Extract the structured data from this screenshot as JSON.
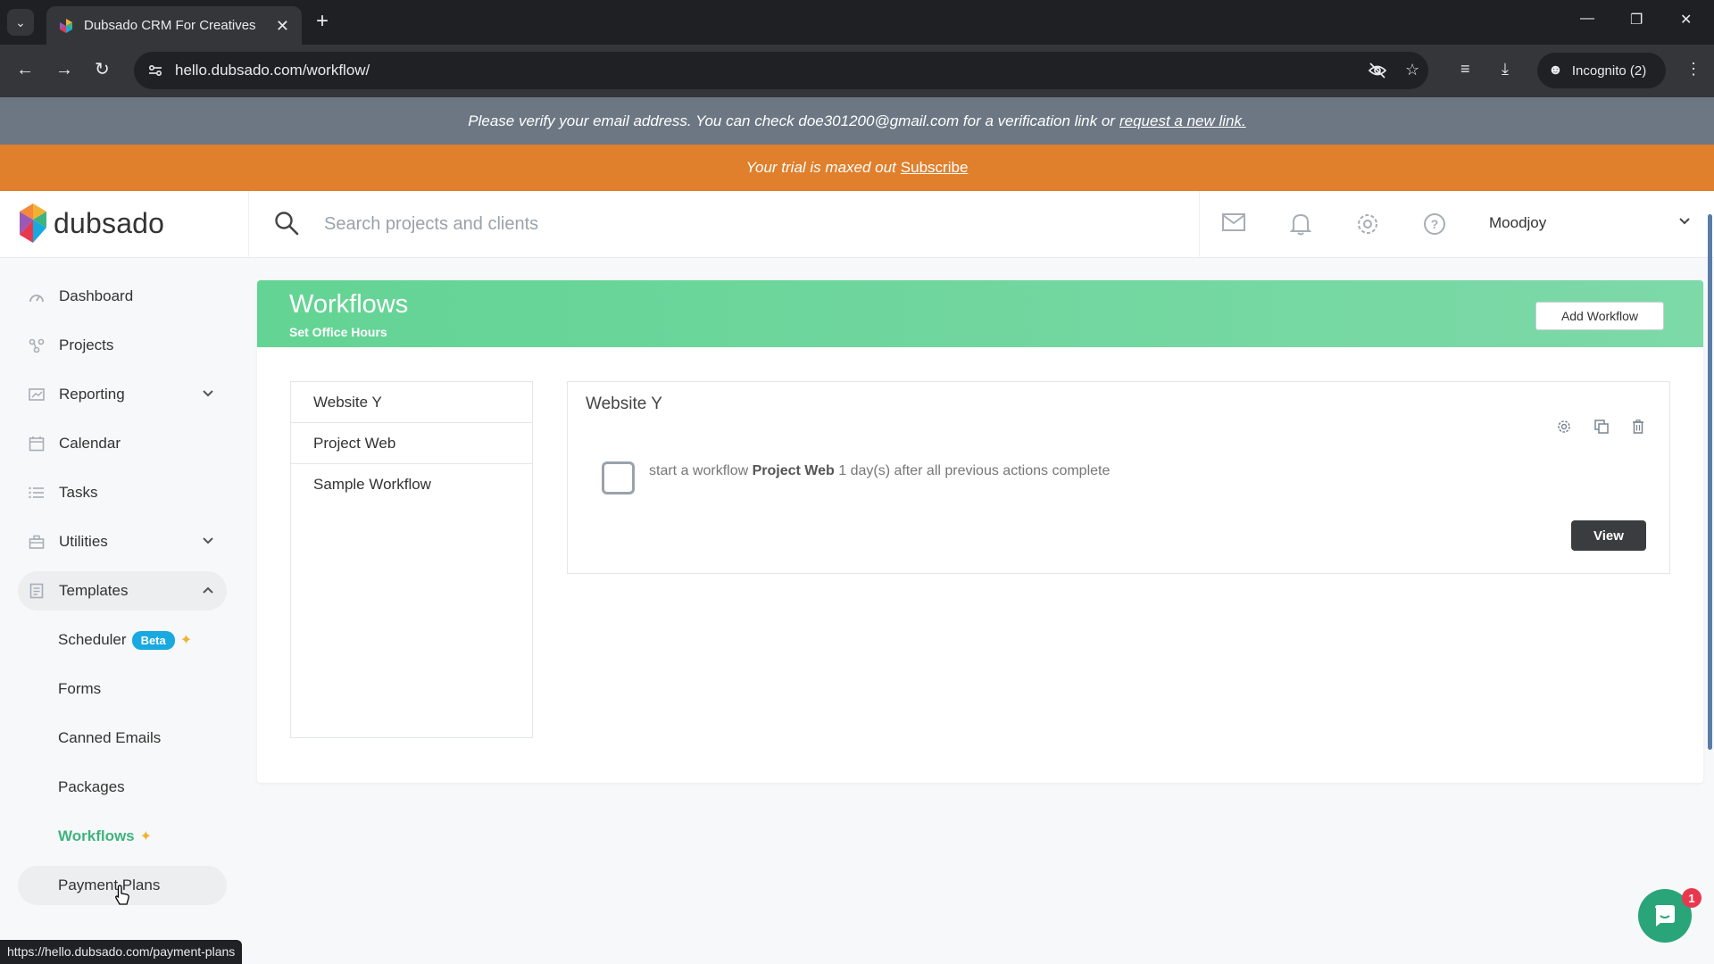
{
  "browser": {
    "tab_title": "Dubsado CRM For Creatives",
    "url": "hello.dubsado.com/workflow/",
    "incognito_label": "Incognito (2)",
    "status_url": "https://hello.dubsado.com/payment-plans"
  },
  "banners": {
    "verify_text": "Please verify your email address. You can check doe301200@gmail.com for a verification link or",
    "verify_link": "request a new link.",
    "trial_text": "Your trial is maxed out",
    "trial_link": "Subscribe"
  },
  "header": {
    "brand": "dubsado",
    "search_placeholder": "Search projects and clients",
    "user_name": "Moodjoy"
  },
  "sidebar": {
    "items": [
      {
        "label": "Dashboard",
        "icon": "dashboard-icon"
      },
      {
        "label": "Projects",
        "icon": "projects-icon"
      },
      {
        "label": "Reporting",
        "icon": "reporting-icon"
      },
      {
        "label": "Calendar",
        "icon": "calendar-icon"
      },
      {
        "label": "Tasks",
        "icon": "tasks-icon"
      },
      {
        "label": "Utilities",
        "icon": "utilities-icon"
      },
      {
        "label": "Templates",
        "icon": "templates-icon"
      }
    ],
    "sub_items": [
      {
        "label": "Scheduler",
        "badge": "Beta"
      },
      {
        "label": "Forms"
      },
      {
        "label": "Canned Emails"
      },
      {
        "label": "Packages"
      },
      {
        "label": "Workflows"
      },
      {
        "label": "Payment Plans"
      }
    ]
  },
  "workflows": {
    "title": "Workflows",
    "subtitle": "Set Office Hours",
    "add_button": "Add Workflow",
    "list": [
      "Website Y",
      "Project Web",
      "Sample Workflow"
    ],
    "detail": {
      "title": "Website Y",
      "step_prefix": "start a workflow",
      "step_bold": "Project Web",
      "step_suffix": "1 day(s) after all previous actions complete",
      "view_button": "View"
    }
  },
  "chat": {
    "badge_count": "1"
  },
  "colors": {
    "accent_green": "#3fb37f",
    "header_gradient": "#63d494",
    "trial_orange": "#e07f2c",
    "verify_gray": "#6c7783",
    "beta_blue": "#18a9e0"
  }
}
